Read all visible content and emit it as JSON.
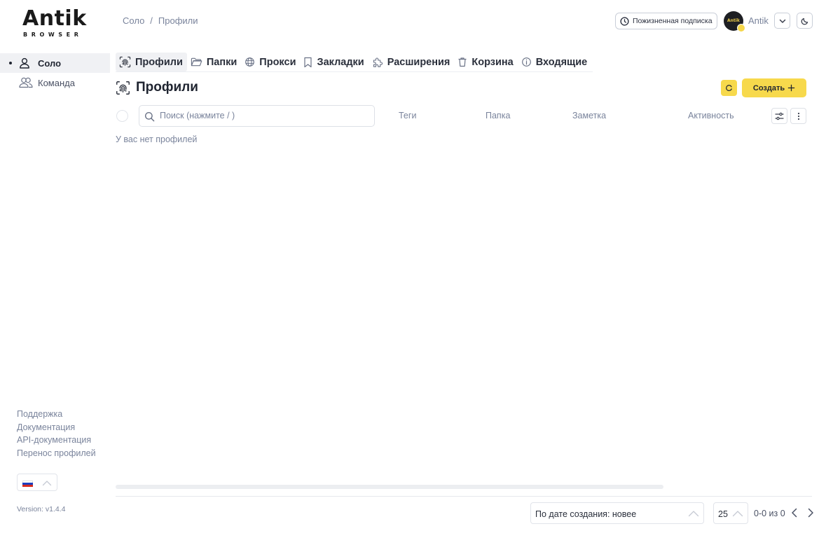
{
  "brand": {
    "wordmark": "Antik",
    "submark": "BROWSER"
  },
  "breadcrumb": {
    "root": "Соло",
    "separator": "/",
    "current": "Профили"
  },
  "header": {
    "subscription_label": "Пожизненная подписка",
    "user_name": "Antik",
    "avatar_text": "Antik",
    "icons": [
      "clock-icon",
      "chevron-down-icon",
      "moon-icon"
    ]
  },
  "sidebar": {
    "items": [
      {
        "label": "Соло",
        "icon": "user-icon",
        "active": true
      },
      {
        "label": "Команда",
        "icon": "users-icon",
        "active": false
      }
    ],
    "links": [
      "Поддержка",
      "Документация",
      "API-документация",
      "Перенос профилей"
    ],
    "version": "Version: v1.4.4",
    "language": "ru"
  },
  "tabs": [
    {
      "label": "Профили",
      "icon": "fingerprint-icon",
      "active": true
    },
    {
      "label": "Папки",
      "icon": "folder-icon",
      "active": false
    },
    {
      "label": "Прокси",
      "icon": "globe-icon",
      "active": false
    },
    {
      "label": "Закладки",
      "icon": "bookmark-icon",
      "active": false
    },
    {
      "label": "Расширения",
      "icon": "puzzle-icon",
      "active": false
    },
    {
      "label": "Корзина",
      "icon": "trash-icon",
      "active": false
    },
    {
      "label": "Входящие",
      "icon": "info-icon",
      "active": false
    }
  ],
  "page": {
    "title": "Профили",
    "create_label": "Создать",
    "search_placeholder": "Поиск (нажмите / )",
    "columns": [
      "Теги",
      "Папка",
      "Заметка",
      "Активность"
    ],
    "empty_message": "У вас нет профилей"
  },
  "footer": {
    "sort_label": "По дате создания: новее",
    "per_page": "25",
    "range": "0-0 из 0"
  },
  "colors": {
    "accent": "#f7d94c",
    "muted_text": "#7a849c",
    "active_bg": "#f0f1f4"
  }
}
